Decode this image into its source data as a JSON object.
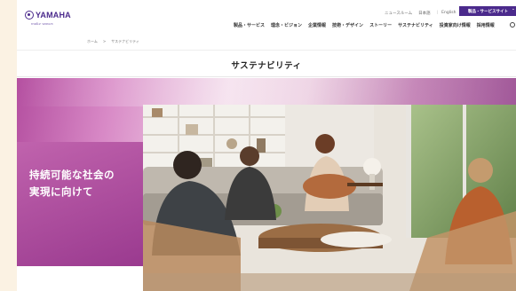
{
  "header": {
    "logo_text": "YAMAHA",
    "logo_tagline": "make waves",
    "utility": [
      "ニュースルーム",
      "日本語",
      "English"
    ],
    "products_button": "製品・サービスサイト",
    "nav": [
      "製品・サービス",
      "理念・ビジョン",
      "企業情報",
      "技術・デザイン",
      "ストーリー",
      "サステナビリティ",
      "投資家向け情報",
      "採用情報"
    ]
  },
  "breadcrumb": [
    "ホーム",
    ">",
    "サステナビリティ"
  ],
  "page_title": "サステナビリティ",
  "hero": {
    "heading_line1": "持続可能な社会の",
    "heading_line2": "実現に向けて"
  },
  "colors": {
    "brand": "#4b2a8c",
    "hero_magenta": "#b44fa0",
    "background": "#fbf2e3"
  }
}
